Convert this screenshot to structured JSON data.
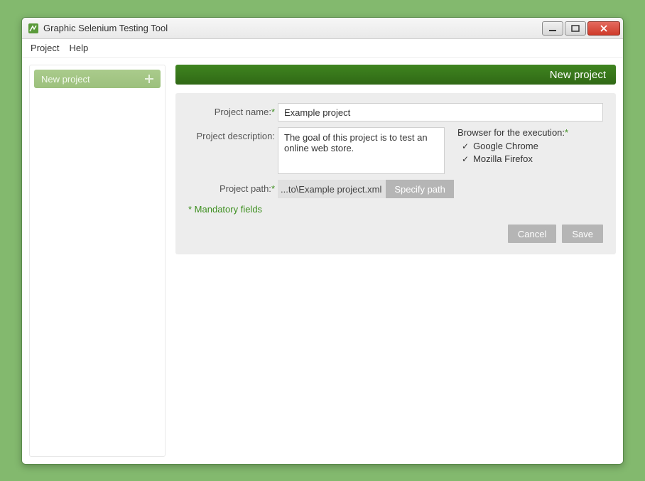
{
  "window": {
    "title": "Graphic Selenium Testing Tool"
  },
  "menu": {
    "project": "Project",
    "help": "Help"
  },
  "sidebar": {
    "new_project": "New project"
  },
  "panel": {
    "header": "New project"
  },
  "form": {
    "name_label": "Project name:",
    "name_value": "Example project",
    "desc_label": "Project description:",
    "desc_value": "The goal of this project is to test an online web store.",
    "browsers_label": "Browser for the execution:",
    "browsers": [
      {
        "label": "Google Chrome",
        "checked": true
      },
      {
        "label": "Mozilla Firefox",
        "checked": true
      }
    ],
    "path_label": "Project path:",
    "path_value": "...to\\Example project.xml",
    "specify_path": "Specify path",
    "mandatory": "* Mandatory fields",
    "cancel": "Cancel",
    "save": "Save"
  }
}
